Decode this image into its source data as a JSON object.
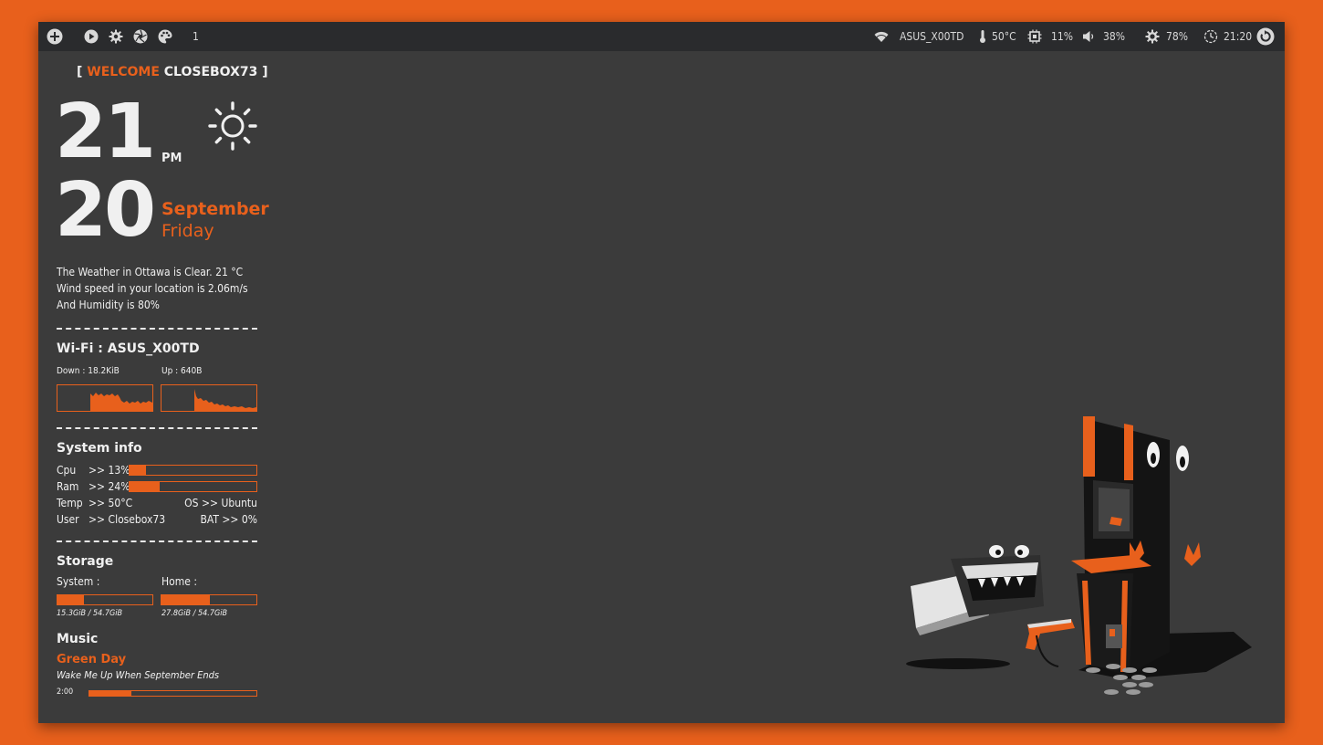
{
  "colors": {
    "accent": "#e8601c",
    "panel": "#3b3b3b",
    "bar": "#2a2b2d",
    "text": "#f0f0f0"
  },
  "topbar": {
    "left_icons": [
      "plus-icon",
      "play-icon",
      "gear-icon",
      "aperture-icon",
      "palette-icon"
    ],
    "workspace": "1",
    "wifi": "ASUS_X00TD",
    "temperature": "50°C",
    "cpu": "11%",
    "volume": "38%",
    "brightness": "78%",
    "clock": "21:20"
  },
  "conky": {
    "welcome": {
      "open": "[",
      "word": "WELCOME",
      "user": "CLOSEBOX73",
      "close": "]"
    },
    "hour": "21",
    "ampm": "PM",
    "day": "20",
    "month": "September",
    "weekday": "Friday",
    "weather": [
      "The Weather in Ottawa is Clear. 21 °C",
      "Wind speed in your location is 2.06m/s",
      "And Humidity is 80%"
    ],
    "wifi_title": "Wi-Fi : ASUS_X00TD",
    "down_label": "Down : 18.2KiB",
    "up_label": "Up : 640B",
    "sysinfo_title": "System info",
    "cpu_label": "Cpu",
    "cpu_value": ">> 13%",
    "cpu_fraction": 0.13,
    "ram_label": "Ram",
    "ram_value": ">> 24%",
    "ram_fraction": 0.24,
    "temp_label": "Temp",
    "temp_value": ">> 50°C",
    "os_text": "OS >> Ubuntu",
    "user_label": "User",
    "user_value": ">> Closebox73",
    "bat_text": "BAT >> 0%",
    "storage_title": "Storage",
    "system_label": "System :",
    "home_label": "Home :",
    "system_usage": "15.3GiB / 54.7GiB",
    "system_fraction": 0.28,
    "home_usage": "27.8GiB / 54.7GiB",
    "home_fraction": 0.51,
    "music_title": "Music",
    "artist": "Green Day",
    "song": "Wake Me Up When September Ends",
    "music_time": "2:00",
    "music_fraction": 0.25
  }
}
